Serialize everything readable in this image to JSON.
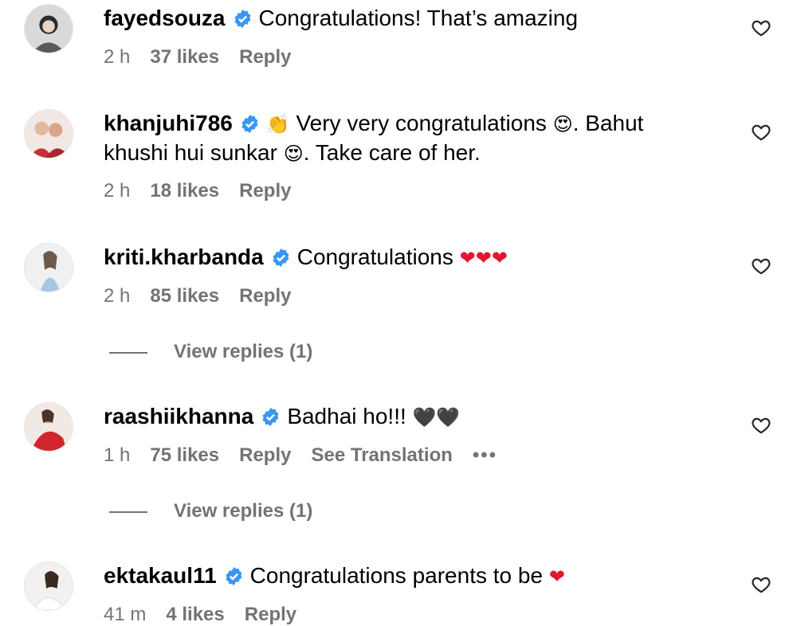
{
  "comments": [
    {
      "username": "fayedsouza",
      "text": "Congratulations! That’s amazing",
      "time": "2 h",
      "likes": "37 likes",
      "reply": "Reply"
    },
    {
      "username": "khanjuhi786",
      "text_line1_prefix_emoji": "👏",
      "text_line1": "Very very congratulations",
      "text_emoji": "😍",
      "text_line1_suffix": ". Bahut",
      "text_line2": "khushi hui sunkar",
      "text_line2_suffix": ". Take care of her.",
      "time": "2 h",
      "likes": "18 likes",
      "reply": "Reply"
    },
    {
      "username": "kriti.kharbanda",
      "text": "Congratulations",
      "text_emoji": "❤❤❤",
      "time": "2 h",
      "likes": "85 likes",
      "reply": "Reply",
      "view_replies": "View replies (1)"
    },
    {
      "username": "raashiikhanna",
      "text": "Badhai ho!!!",
      "text_emoji": "🖤🖤",
      "time": "1 h",
      "likes": "75 likes",
      "reply": "Reply",
      "see_translation": "See Translation",
      "more": "•••",
      "view_replies": "View replies (1)"
    },
    {
      "username": "ektakaul11",
      "text": "Congratulations parents to be",
      "text_emoji": "❤",
      "time": "41 m",
      "likes": "4 likes",
      "reply": "Reply"
    }
  ],
  "icons": {
    "verified": "verified-badge-icon",
    "like": "heart-outline-icon"
  },
  "colors": {
    "verified_blue": "#3897f0",
    "meta_gray": "#737373",
    "heart_red": "#e0182d"
  }
}
